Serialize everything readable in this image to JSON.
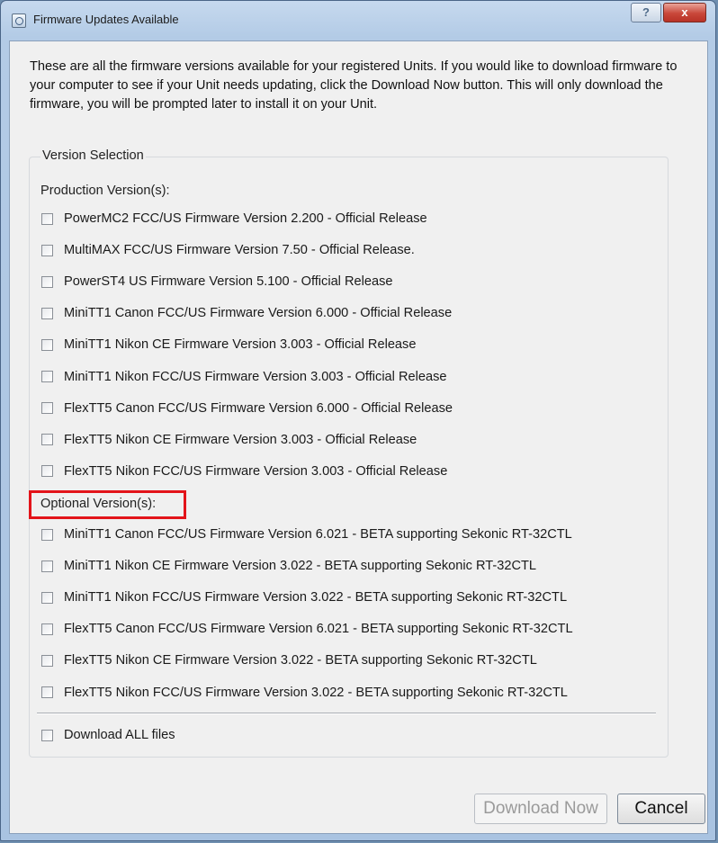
{
  "window": {
    "title": "Firmware Updates Available",
    "help_label": "?",
    "close_label": "x"
  },
  "intro_text": "These are all the firmware versions available for your registered Units.  If you would like to download firmware to your computer to see if your Unit needs updating, click the Download Now button.  This will only download the firmware, you will be prompted later to install it on your Unit.",
  "version_selection": {
    "legend": "Version Selection",
    "production_label": "Production Version(s):",
    "production_items": [
      {
        "label": "PowerMC2 FCC/US Firmware Version 2.200 - Official Release",
        "checked": false
      },
      {
        "label": "MultiMAX FCC/US Firmware Version 7.50 - Official Release.",
        "checked": false
      },
      {
        "label": "PowerST4 US Firmware Version 5.100 - Official Release",
        "checked": false
      },
      {
        "label": "MiniTT1 Canon FCC/US Firmware Version 6.000 - Official Release",
        "checked": false
      },
      {
        "label": "MiniTT1 Nikon CE Firmware Version 3.003 - Official Release",
        "checked": false
      },
      {
        "label": "MiniTT1 Nikon FCC/US Firmware Version 3.003 - Official Release",
        "checked": false
      },
      {
        "label": "FlexTT5 Canon FCC/US Firmware Version 6.000 - Official Release",
        "checked": false
      },
      {
        "label": "FlexTT5 Nikon CE Firmware Version 3.003 - Official Release",
        "checked": false
      },
      {
        "label": "FlexTT5 Nikon FCC/US Firmware Version 3.003 - Official Release",
        "checked": false
      }
    ],
    "optional_label": "Optional Version(s):",
    "optional_items": [
      {
        "label": "MiniTT1 Canon FCC/US Firmware Version 6.021 - BETA supporting Sekonic RT-32CTL",
        "checked": false
      },
      {
        "label": "MiniTT1 Nikon CE Firmware Version 3.022 - BETA supporting Sekonic RT-32CTL",
        "checked": false
      },
      {
        "label": "MiniTT1 Nikon FCC/US Firmware Version 3.022 - BETA supporting Sekonic RT-32CTL",
        "checked": false
      },
      {
        "label": "FlexTT5 Canon FCC/US Firmware Version 6.021 - BETA supporting Sekonic RT-32CTL",
        "checked": false
      },
      {
        "label": "FlexTT5 Nikon CE Firmware Version 3.022 - BETA supporting Sekonic RT-32CTL",
        "checked": false
      },
      {
        "label": "FlexTT5 Nikon FCC/US Firmware Version 3.022 - BETA supporting Sekonic RT-32CTL",
        "checked": false
      }
    ],
    "download_all": {
      "label": "Download ALL files",
      "checked": false
    }
  },
  "buttons": {
    "download_now": "Download Now",
    "download_now_enabled": false,
    "cancel": "Cancel"
  },
  "highlight_color": "#e3141a"
}
